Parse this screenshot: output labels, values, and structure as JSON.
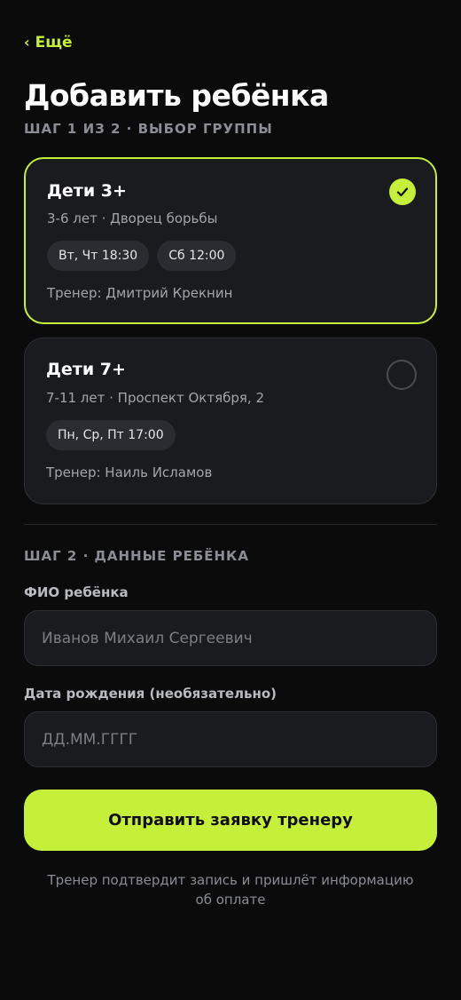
{
  "nav": {
    "back_label": "Ещё"
  },
  "header": {
    "title": "Добавить ребёнка",
    "step1": "ШАГ 1 ИЗ 2 · ВЫБОР ГРУППЫ"
  },
  "groups": [
    {
      "name": "Дети 3+",
      "subtitle": "3-6 лет · Дворец борьбы",
      "schedule": [
        "Вт, Чт 18:30",
        "Сб 12:00"
      ],
      "coach": "Тренер: Дмитрий Крекнин",
      "selected": true
    },
    {
      "name": "Дети 7+",
      "subtitle": "7-11 лет · Проспект Октября, 2",
      "schedule": [
        "Пн, Ср, Пт 17:00"
      ],
      "coach": "Тренер: Наиль Исламов",
      "selected": false
    }
  ],
  "step2": {
    "title": "ШАГ 2 · ДАННЫЕ РЕБЁНКА",
    "fio_label": "ФИО ребёнка",
    "fio_placeholder": "Иванов Михаил Сергеевич",
    "date_label": "Дата рождения (необязательно)",
    "date_placeholder": "ДД.ММ.ГГГГ"
  },
  "submit_label": "Отправить заявку тренеру",
  "note": "Тренер подтвердит запись и пришлёт информацию об оплате",
  "colors": {
    "accent": "#c6ef3a",
    "background": "#0b0b0c",
    "card": "#1a1b1f"
  }
}
